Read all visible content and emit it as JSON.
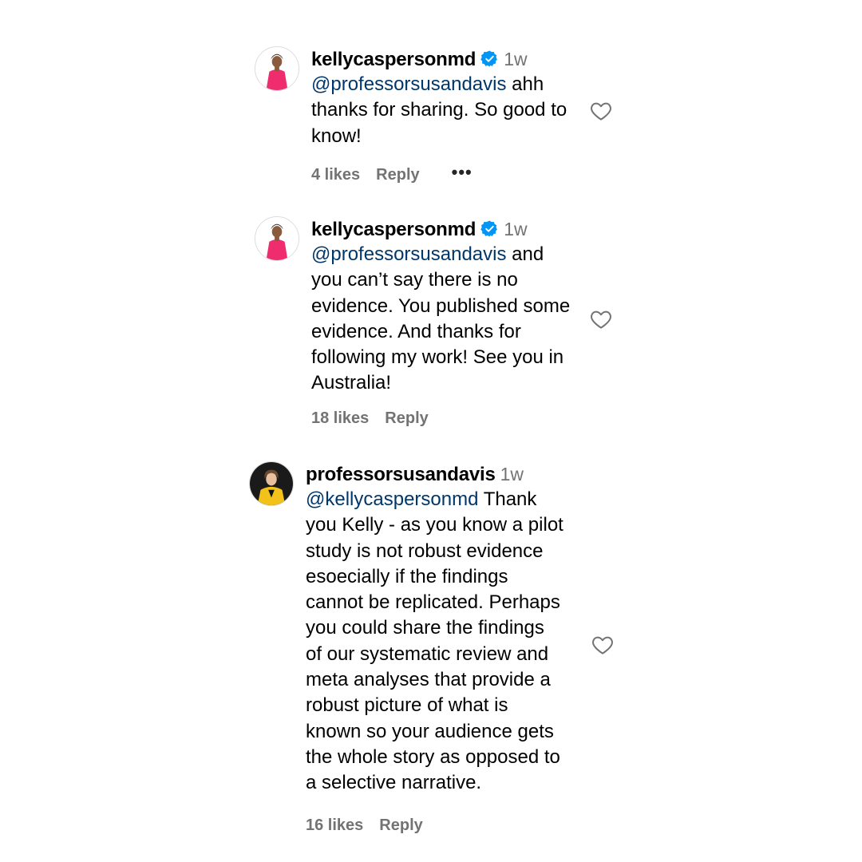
{
  "comments": [
    {
      "username": "kellycaspersonmd",
      "verified": true,
      "time": "1w",
      "mention": "@professorsusandavis",
      "text": " ahh\nthanks for sharing. So good to\nknow!",
      "likes": "4 likes",
      "reply": "Reply",
      "more": "•••",
      "avatar_color": "#ef2d6e"
    },
    {
      "username": "kellycaspersonmd",
      "verified": true,
      "time": "1w",
      "mention": "@professorsusandavis",
      "text": " and\nyou can’t say there is no\nevidence. You published some\nevidence. And thanks for\nfollowing my work! See you in\nAustralia!",
      "likes": "18 likes",
      "reply": "Reply",
      "avatar_color": "#ef2d6e"
    },
    {
      "username": "professorsusandavis",
      "verified": false,
      "time": "1w",
      "mention": "@kellycaspersonmd",
      "text": " Thank\nyou Kelly - as you know a pilot\nstudy is not robust evidence\nesoecially if the findings\ncannot be replicated. Perhaps\nyou could share the findings\nof our systematic review and\nmeta analyses that provide a\nrobust picture of what is\nknown so your audience gets\nthe whole story as opposed to\na selective narrative.",
      "likes": "16 likes",
      "reply": "Reply",
      "avatar_color": "#f2c21b"
    }
  ],
  "colors": {
    "mention": "#00376b",
    "secondary_text": "#737373",
    "verified_badge": "#0095f6"
  }
}
